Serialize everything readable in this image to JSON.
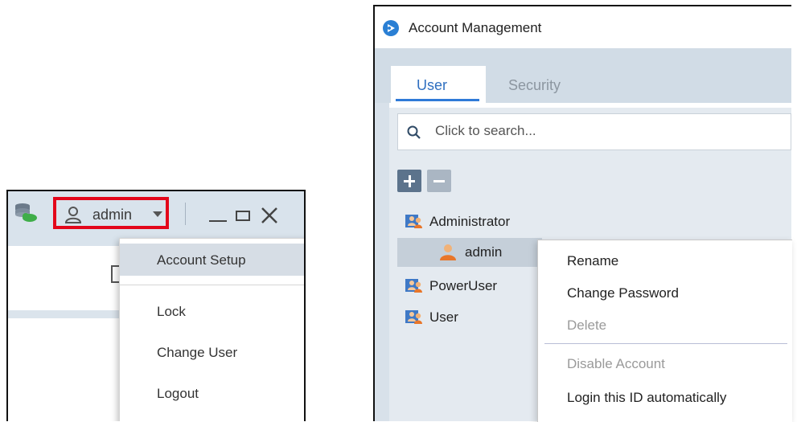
{
  "left_panel": {
    "user_name": "admin",
    "menu": [
      "Account Setup",
      "Lock",
      "Change User",
      "Logout"
    ],
    "highlight_color": "#e3061a"
  },
  "right_panel": {
    "title": "Account Management",
    "tabs": [
      "User",
      "Security"
    ],
    "search_placeholder": "Click to search...",
    "tree": [
      "Administrator",
      "admin",
      "PowerUser",
      "User"
    ],
    "context_menu": {
      "rename": "Rename",
      "change_password": "Change Password",
      "delete": "Delete",
      "disable_account": "Disable Account",
      "login_auto": "Login this ID automatically"
    },
    "accent_color": "#2f7ad8"
  }
}
